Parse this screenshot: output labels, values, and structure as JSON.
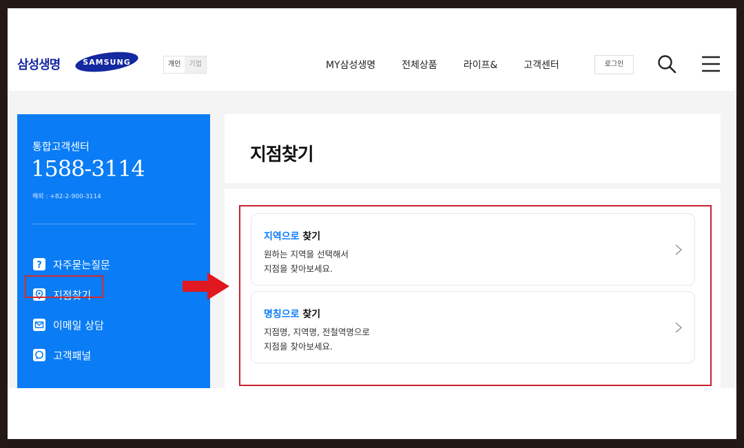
{
  "brand": {
    "name": "삼성생명",
    "samsung_logo": "SAMSUNG"
  },
  "segment": {
    "personal": "개인",
    "corporate": "기업"
  },
  "nav": {
    "items": [
      "MY삼성생명",
      "전체상품",
      "라이프&",
      "고객센터"
    ],
    "login_label": "로그인"
  },
  "icons": {
    "search": "search-icon",
    "menu": "hamburger-menu-icon",
    "faq": "question-icon",
    "branch": "location-pin-icon",
    "email": "mail-icon",
    "panel": "chat-bubble-icon",
    "chevron": "chevron-right-icon"
  },
  "sidebar": {
    "center_label": "통합고객센터",
    "phone": "1588-3114",
    "overseas": "해외 : +82-2-900-3114",
    "items": [
      {
        "label": "자주묻는질문"
      },
      {
        "label": "지점찾기"
      },
      {
        "label": "이메일 상담"
      },
      {
        "label": "고객패널"
      }
    ]
  },
  "main": {
    "title": "지점찾기",
    "cards": [
      {
        "title_accent": "지역으로",
        "title_rest": " 찾기",
        "desc_line1": "원하는 지역을 선택해서",
        "desc_line2": "지점을 찾아보세요."
      },
      {
        "title_accent": "명칭으로",
        "title_rest": " 찾기",
        "desc_line1": "지점명, 지역명, 전철역명으로",
        "desc_line2": "지점을 찾아보세요."
      }
    ]
  },
  "colors": {
    "accent_blue": "#0a7cf5",
    "brand_navy": "#1428a0",
    "annotation_red": "#d72a2a",
    "frame": "#231815"
  }
}
